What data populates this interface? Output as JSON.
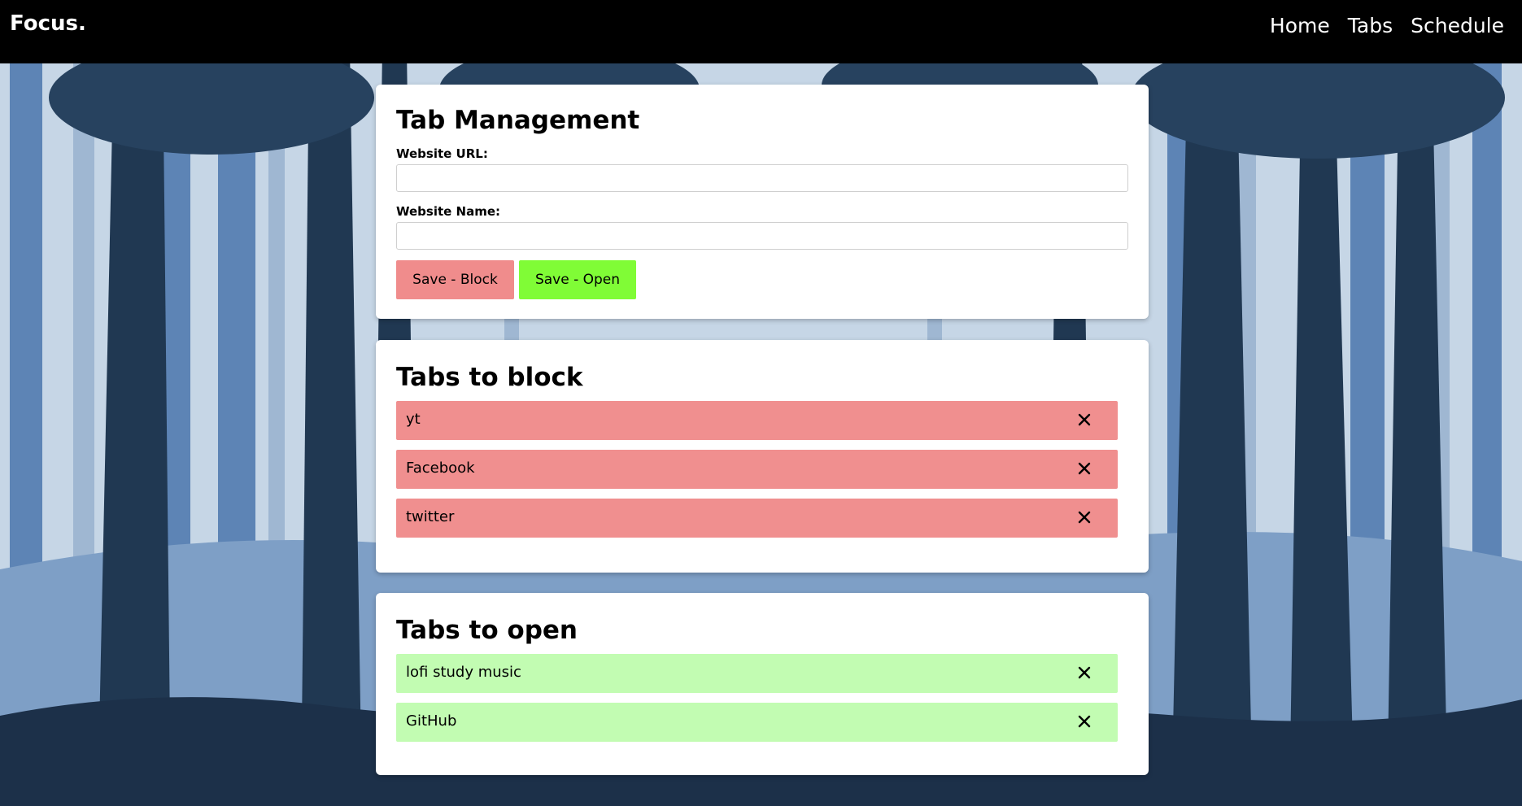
{
  "nav": {
    "brand": "Focus.",
    "links": [
      "Home",
      "Tabs",
      "Schedule"
    ]
  },
  "manage": {
    "title": "Tab Management",
    "url_label": "Website URL:",
    "url_value": "",
    "name_label": "Website Name:",
    "name_value": "",
    "save_block_label": "Save - Block",
    "save_open_label": "Save - Open"
  },
  "block": {
    "title": "Tabs to block",
    "items": [
      "yt",
      "Facebook",
      "twitter"
    ]
  },
  "open": {
    "title": "Tabs to open",
    "items": [
      "lofi study music",
      "GitHub"
    ]
  },
  "colors": {
    "navbar": "#000000",
    "block_button": "#f08c8c",
    "open_button": "#80fc36",
    "block_item": "#f08f8f",
    "open_item": "#c2fcb2",
    "card": "#ffffff"
  },
  "icons": {
    "remove": "close-icon"
  }
}
